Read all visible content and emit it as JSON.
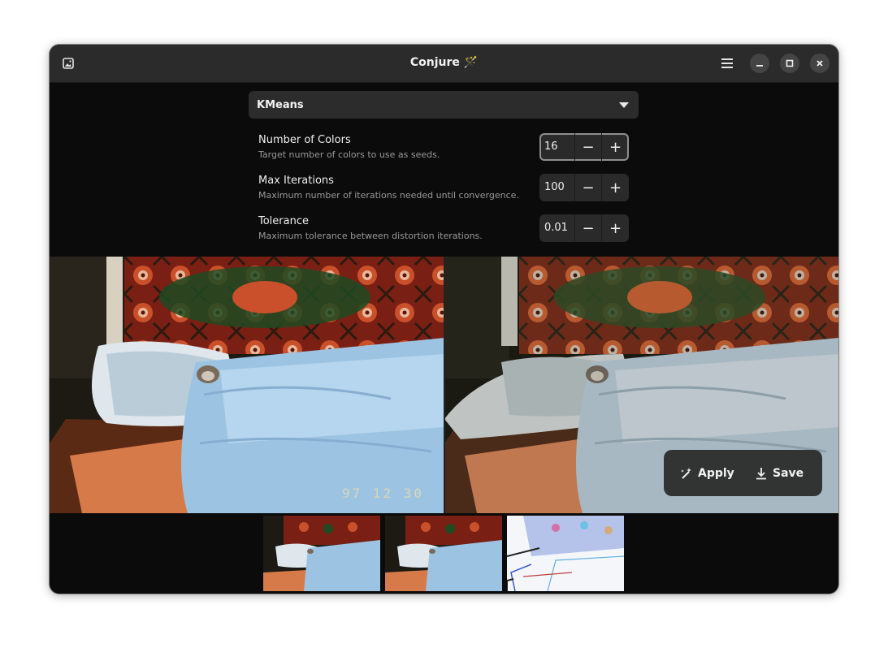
{
  "window": {
    "title": "Conjure 🪄"
  },
  "icons": {
    "open_image": "image-icon",
    "menu": "hamburger-menu-icon",
    "minimize": "minimize-icon",
    "maximize": "maximize-icon",
    "close": "close-icon",
    "apply": "magic-wand-icon",
    "save": "download-icon"
  },
  "algorithm": {
    "selected": "KMeans"
  },
  "settings": [
    {
      "title": "Number of Colors",
      "subtitle": "Target number of colors to use as seeds.",
      "value": "16"
    },
    {
      "title": "Max Iterations",
      "subtitle": "Maximum number of iterations needed until convergence.",
      "value": "100"
    },
    {
      "title": "Tolerance",
      "subtitle": "Maximum tolerance between distortion iterations.",
      "value": "0.01"
    }
  ],
  "spin": {
    "minus": "−",
    "plus": "+"
  },
  "preview": {
    "date_stamp": "97 12 30"
  },
  "actions": {
    "apply_label": "Apply",
    "save_label": "Save"
  },
  "colors": {
    "window_bg": "#0b0b0b",
    "headerbar_bg": "#2b2b2b",
    "control_bg": "#2c2c2c"
  }
}
